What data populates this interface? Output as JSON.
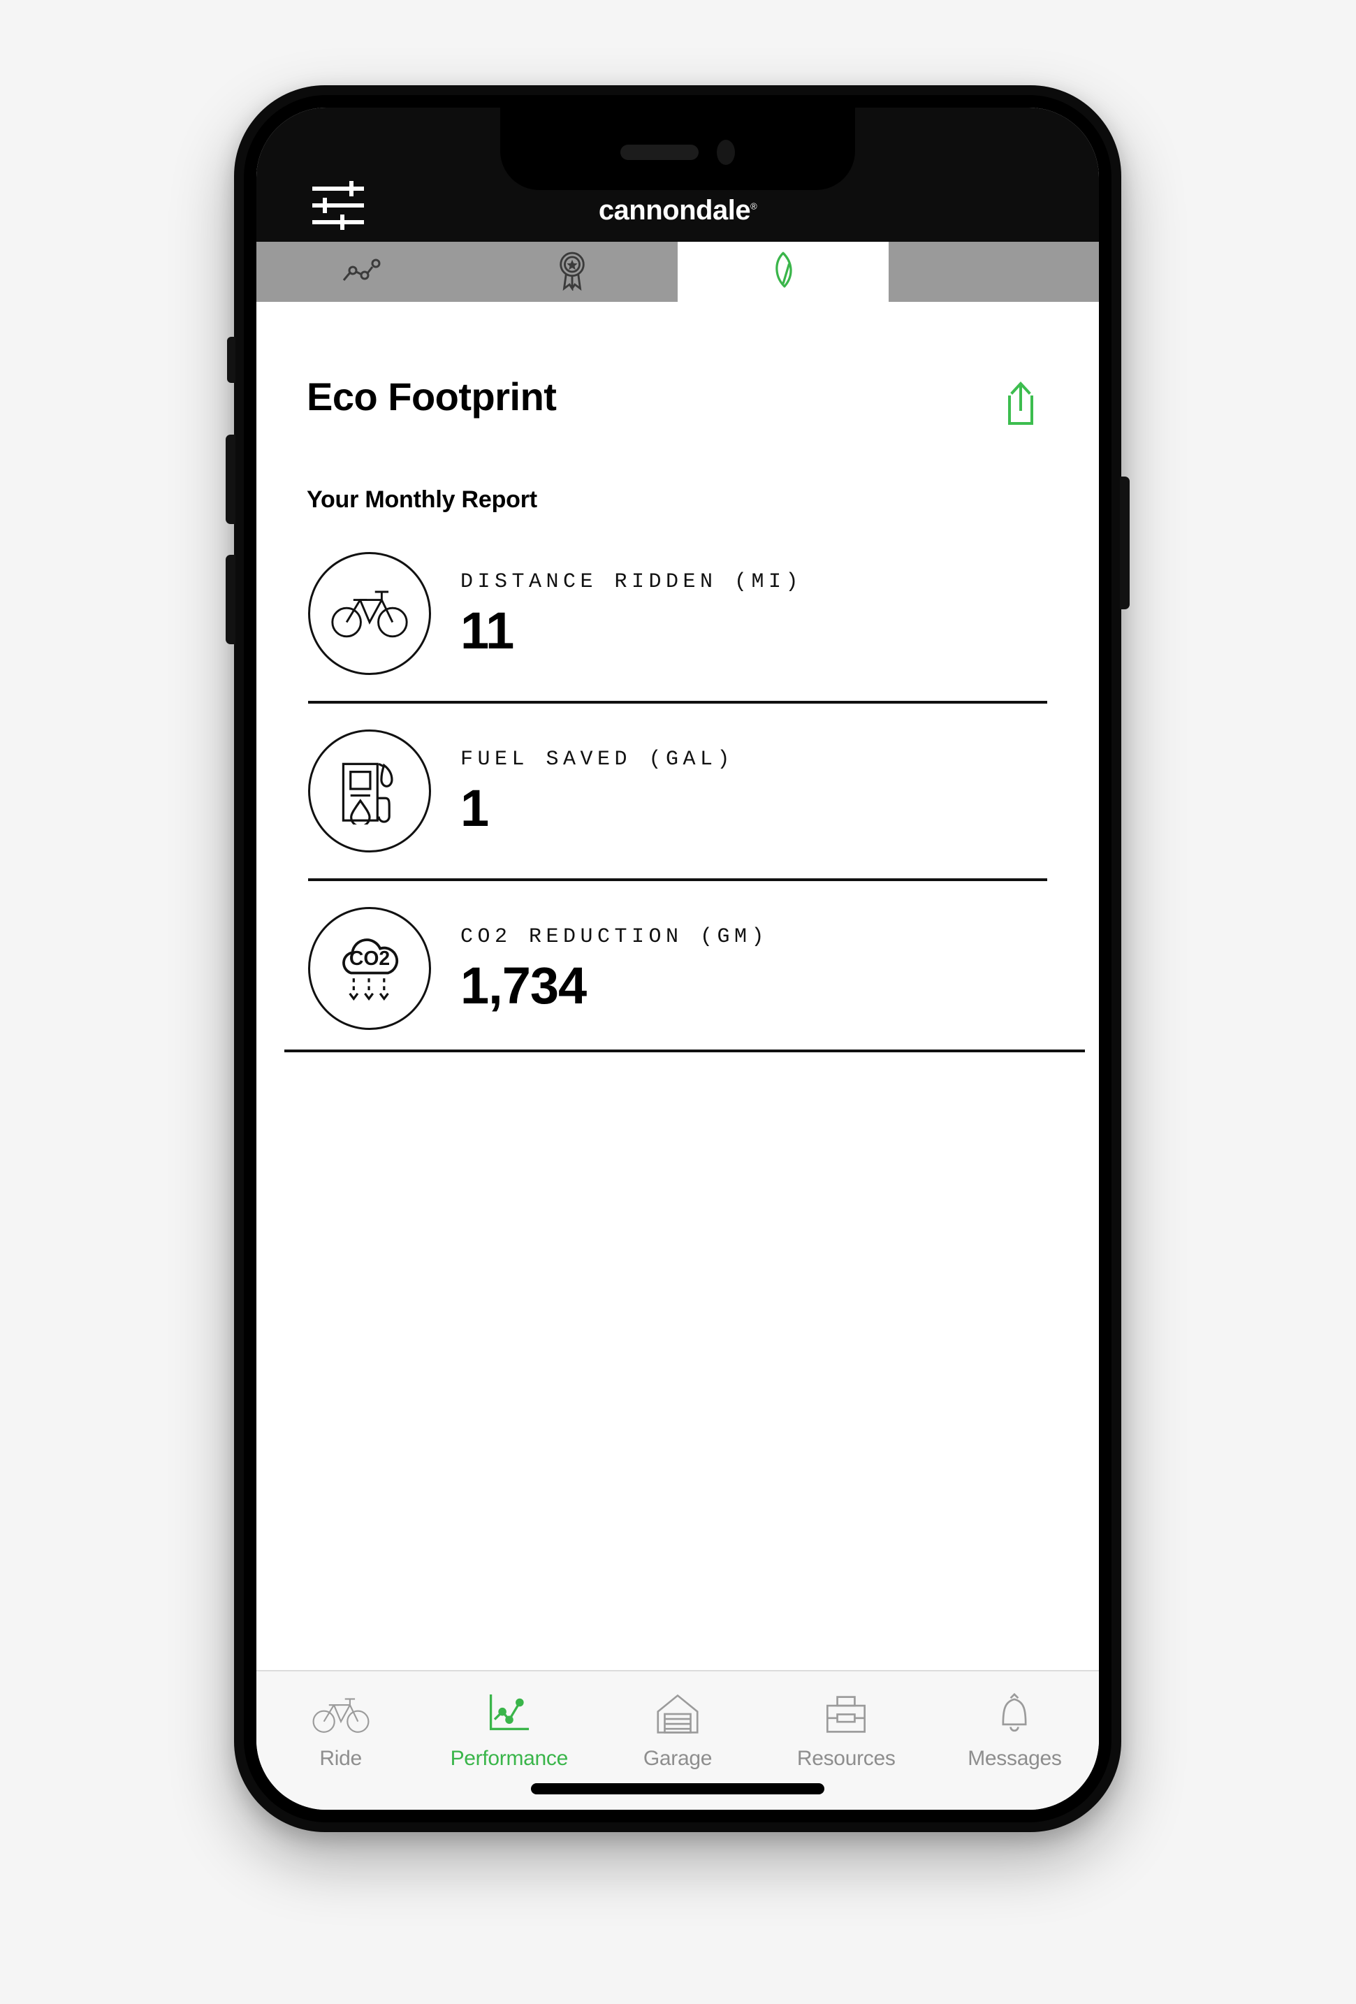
{
  "theme": {
    "brand_green": "#3ab54a",
    "share_green": "#3dbd4f",
    "app_bar_bg": "#0d0d0d",
    "segment_bg": "#9a9a9a",
    "segment_active_bg": "#ffffff",
    "ink": "#111111",
    "nav_inactive": "#8e8e8e",
    "page_bg": "#f5f5f5"
  },
  "app_bar": {
    "menu_icon": "sliders-icon",
    "wordmark": "cannondale",
    "wordmark_trademark": "®"
  },
  "segment_tabs": [
    {
      "name": "activity",
      "icon": "line-chart-icon",
      "active": false
    },
    {
      "name": "achievements",
      "icon": "award-ribbon-icon",
      "active": false
    },
    {
      "name": "eco",
      "icon": "leaf-icon",
      "active": true
    },
    {
      "name": "empty",
      "icon": "",
      "active": false
    }
  ],
  "page": {
    "title": "Eco Footprint",
    "share_icon": "share-upload-icon",
    "subtitle": "Your Monthly Report"
  },
  "metrics": [
    {
      "icon": "bicycle-icon",
      "label": "DISTANCE RIDDEN (MI)",
      "value": "11"
    },
    {
      "icon": "fuel-pump-icon",
      "label": "FUEL SAVED (GAL)",
      "value": "1"
    },
    {
      "icon": "co2-cloud-icon",
      "label": "CO2 REDUCTION (GM)",
      "value": "1,734"
    }
  ],
  "bottom_nav": [
    {
      "label": "Ride",
      "icon": "bicycle-icon",
      "active": false
    },
    {
      "label": "Performance",
      "icon": "chart-icon",
      "active": true
    },
    {
      "label": "Garage",
      "icon": "garage-icon",
      "active": false
    },
    {
      "label": "Resources",
      "icon": "toolbox-icon",
      "active": false
    },
    {
      "label": "Messages",
      "icon": "bell-icon",
      "active": false
    }
  ]
}
